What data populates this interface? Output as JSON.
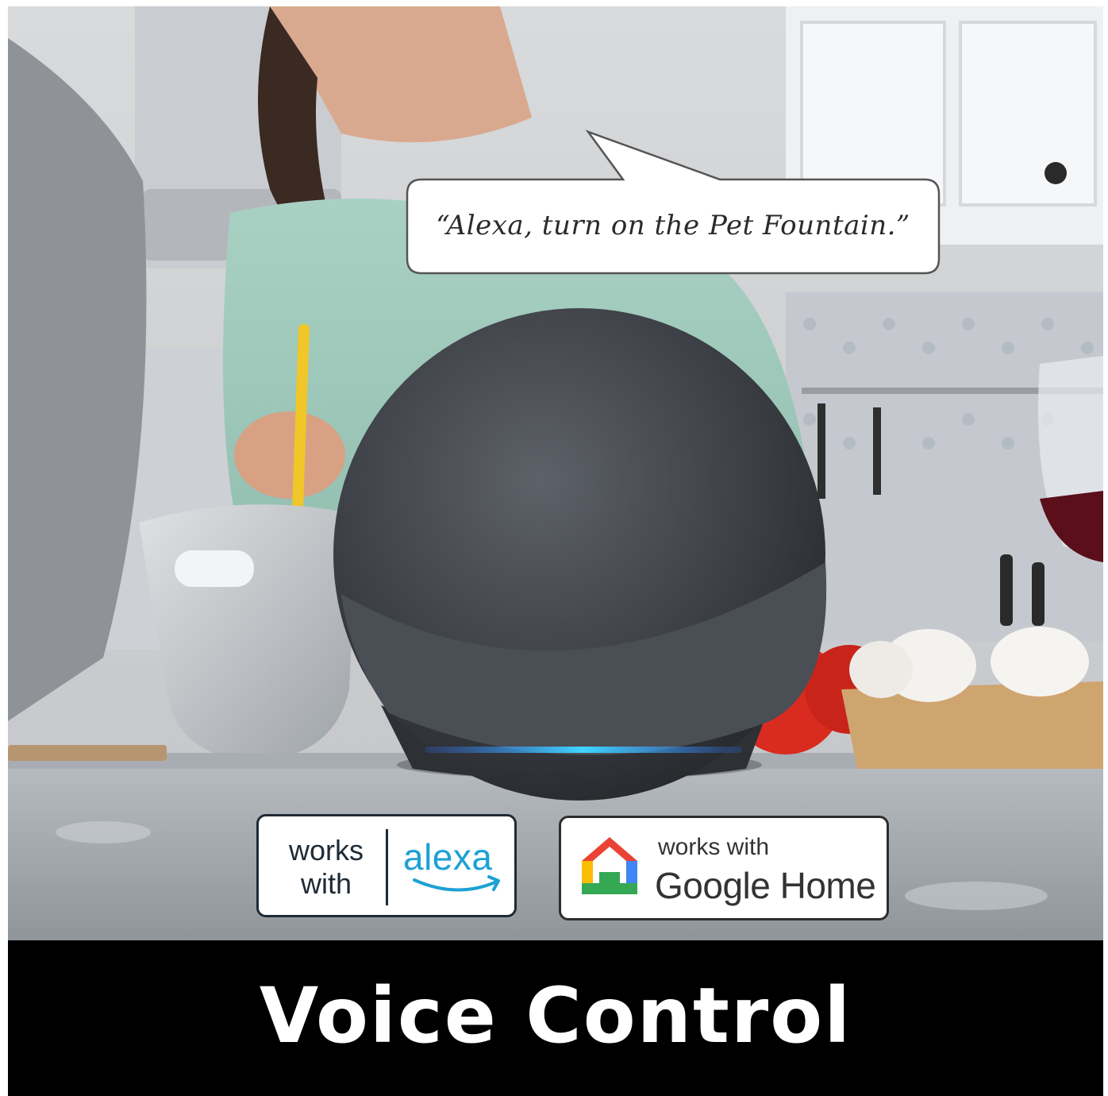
{
  "speech_bubble": {
    "quote": "“Alexa, turn on the Pet Fountain.”"
  },
  "badges": {
    "alexa": {
      "works_line1": "works",
      "works_line2": "with",
      "brand": "alexa",
      "brand_color": "#1da1d4"
    },
    "google": {
      "works_with": "works with",
      "brand": "Google Home"
    }
  },
  "footer": {
    "title": "Voice Control",
    "background": "#000000"
  },
  "icons": {
    "google_home": "google-home-icon",
    "alexa_smile": "amazon-smile-icon"
  }
}
